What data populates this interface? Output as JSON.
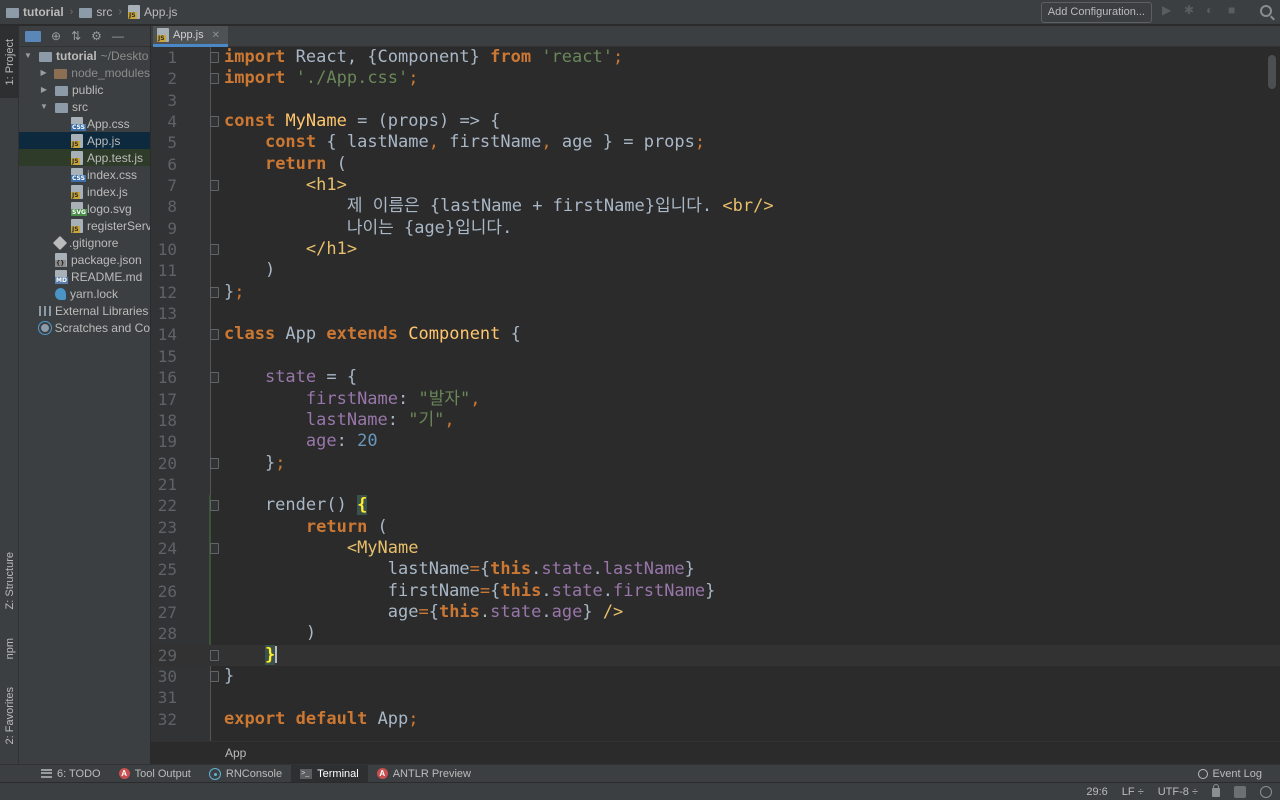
{
  "navbar": {
    "crumbs": [
      "tutorial",
      "src",
      "App.js"
    ],
    "add_configuration": "Add Configuration..."
  },
  "left_strip": {
    "project": "1: Project",
    "structure": "Z: Structure",
    "npm": "npm",
    "favorites": "2: Favorites"
  },
  "project_tree": [
    {
      "label": "tutorial",
      "hint": "~/Deskto",
      "type": "folder",
      "level": 0,
      "expanded": true
    },
    {
      "label": "node_modules",
      "type": "folder-excluded",
      "level": 1,
      "expanded": false
    },
    {
      "label": "public",
      "type": "folder",
      "level": 1,
      "expanded": false
    },
    {
      "label": "src",
      "type": "folder",
      "level": 1,
      "expanded": true
    },
    {
      "label": "App.css",
      "type": "css",
      "level": 2
    },
    {
      "label": "App.js",
      "type": "js",
      "level": 2,
      "selected": true
    },
    {
      "label": "App.test.js",
      "type": "js",
      "level": 2
    },
    {
      "label": "index.css",
      "type": "css",
      "level": 2
    },
    {
      "label": "index.js",
      "type": "js",
      "level": 2
    },
    {
      "label": "logo.svg",
      "type": "svg",
      "level": 2
    },
    {
      "label": "registerServ",
      "type": "js",
      "level": 2
    },
    {
      "label": ".gitignore",
      "type": "git",
      "level": 1
    },
    {
      "label": "package.json",
      "type": "json",
      "level": 1
    },
    {
      "label": "README.md",
      "type": "md",
      "level": 1
    },
    {
      "label": "yarn.lock",
      "type": "yarn",
      "level": 1
    },
    {
      "label": "External Libraries",
      "type": "lib",
      "level": 0
    },
    {
      "label": "Scratches and Co",
      "type": "scratch",
      "level": 0
    }
  ],
  "editor": {
    "tab": "App.js",
    "current_line": 29,
    "lines": [
      [
        [
          "kw",
          "import"
        ],
        [
          "t",
          " React, {Component} "
        ],
        [
          "kw",
          "from"
        ],
        [
          "t",
          " "
        ],
        [
          "str",
          "'react'"
        ],
        [
          "kwn",
          ";"
        ]
      ],
      [
        [
          "kw",
          "import"
        ],
        [
          "t",
          " "
        ],
        [
          "str",
          "'./App.css'"
        ],
        [
          "kwn",
          ";"
        ]
      ],
      [],
      [
        [
          "kw",
          "const"
        ],
        [
          "t",
          " "
        ],
        [
          "fn",
          "MyName"
        ],
        [
          "t",
          " = (props) => {"
        ]
      ],
      [
        [
          "t",
          "    "
        ],
        [
          "kw",
          "const"
        ],
        [
          "t",
          " { lastName"
        ],
        [
          "kwn",
          ","
        ],
        [
          "t",
          " firstName"
        ],
        [
          "kwn",
          ","
        ],
        [
          "t",
          " age } = props"
        ],
        [
          "kwn",
          ";"
        ]
      ],
      [
        [
          "t",
          "    "
        ],
        [
          "kw",
          "return"
        ],
        [
          "t",
          " ("
        ]
      ],
      [
        [
          "t",
          "        "
        ],
        [
          "tag",
          "<h1>"
        ]
      ],
      [
        [
          "t",
          "            제 이름은 {lastName + firstName}입니다. "
        ],
        [
          "tag",
          "<br/>"
        ]
      ],
      [
        [
          "t",
          "            나이는 {age}입니다."
        ]
      ],
      [
        [
          "t",
          "        "
        ],
        [
          "tag",
          "</h1>"
        ]
      ],
      [
        [
          "t",
          "    )"
        ]
      ],
      [
        [
          "t",
          "}"
        ],
        [
          "kwn",
          ";"
        ]
      ],
      [],
      [
        [
          "kw",
          "class"
        ],
        [
          "t",
          " App "
        ],
        [
          "kw",
          "extends"
        ],
        [
          "t",
          " "
        ],
        [
          "fn",
          "Component"
        ],
        [
          "t",
          " {"
        ]
      ],
      [],
      [
        [
          "t",
          "    "
        ],
        [
          "prop",
          "state"
        ],
        [
          "t",
          " = {"
        ]
      ],
      [
        [
          "t",
          "        "
        ],
        [
          "prop",
          "firstName"
        ],
        [
          "t",
          ": "
        ],
        [
          "str",
          "\"발자\""
        ],
        [
          "kwn",
          ","
        ]
      ],
      [
        [
          "t",
          "        "
        ],
        [
          "prop",
          "lastName"
        ],
        [
          "t",
          ": "
        ],
        [
          "str",
          "\"기\""
        ],
        [
          "kwn",
          ","
        ]
      ],
      [
        [
          "t",
          "        "
        ],
        [
          "prop",
          "age"
        ],
        [
          "t",
          ": "
        ],
        [
          "num",
          "20"
        ]
      ],
      [
        [
          "t",
          "    }"
        ],
        [
          "kwn",
          ";"
        ]
      ],
      [],
      [
        [
          "t",
          "    render() "
        ],
        [
          "hl",
          "{"
        ]
      ],
      [
        [
          "t",
          "        "
        ],
        [
          "kw",
          "return"
        ],
        [
          "t",
          " ("
        ]
      ],
      [
        [
          "t",
          "            "
        ],
        [
          "tag",
          "<MyName"
        ]
      ],
      [
        [
          "t",
          "                lastName"
        ],
        [
          "kwn",
          "="
        ],
        [
          "t",
          "{"
        ],
        [
          "kw",
          "this"
        ],
        [
          "t",
          "."
        ],
        [
          "prop",
          "state"
        ],
        [
          "t",
          "."
        ],
        [
          "prop",
          "lastName"
        ],
        [
          "t",
          "}"
        ]
      ],
      [
        [
          "t",
          "                firstName"
        ],
        [
          "kwn",
          "="
        ],
        [
          "t",
          "{"
        ],
        [
          "kw",
          "this"
        ],
        [
          "t",
          "."
        ],
        [
          "prop",
          "state"
        ],
        [
          "t",
          "."
        ],
        [
          "prop",
          "firstName"
        ],
        [
          "t",
          "}"
        ]
      ],
      [
        [
          "t",
          "                age"
        ],
        [
          "kwn",
          "="
        ],
        [
          "t",
          "{"
        ],
        [
          "kw",
          "this"
        ],
        [
          "t",
          "."
        ],
        [
          "prop",
          "state"
        ],
        [
          "t",
          "."
        ],
        [
          "prop",
          "age"
        ],
        [
          "t",
          "} "
        ],
        [
          "tag",
          "/>"
        ]
      ],
      [
        [
          "t",
          "        )"
        ]
      ],
      [
        [
          "t",
          "    "
        ],
        [
          "hl",
          "}"
        ],
        [
          "caret",
          ""
        ]
      ],
      [
        [
          "t",
          "}"
        ]
      ],
      [],
      [
        [
          "kw",
          "export"
        ],
        [
          "t",
          " "
        ],
        [
          "kw",
          "default"
        ],
        [
          "t",
          " App"
        ],
        [
          "kwn",
          ";"
        ]
      ]
    ],
    "fold_lines": [
      1,
      2,
      4,
      7,
      10,
      12,
      14,
      16,
      20,
      22,
      24,
      29,
      30
    ]
  },
  "breadcrumb": "App",
  "tool_windows": [
    {
      "label": "6: TODO",
      "icon": "todo-icon"
    },
    {
      "label": "Tool Output",
      "icon": "tool-output-icon"
    },
    {
      "label": "RNConsole",
      "icon": "react-icon"
    },
    {
      "label": "Terminal",
      "icon": "terminal-icon",
      "active": true
    },
    {
      "label": "ANTLR Preview",
      "icon": "antlr-icon"
    }
  ],
  "event_log": "Event Log",
  "status": {
    "position": "29:6",
    "line_sep": "LF ÷",
    "encoding": "UTF-8 ÷"
  }
}
